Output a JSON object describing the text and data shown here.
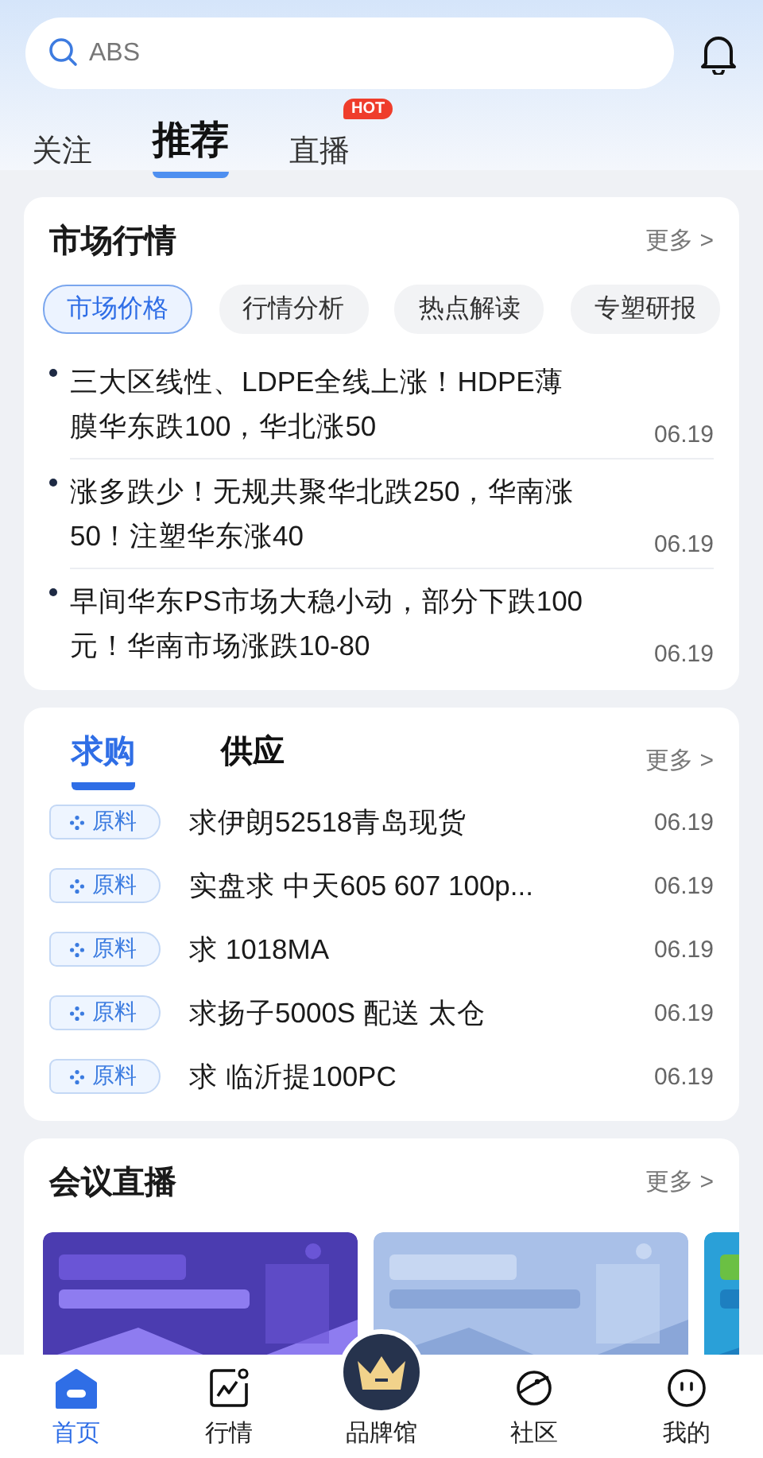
{
  "search": {
    "placeholder": "ABS"
  },
  "top_tabs": [
    {
      "label": "关注",
      "selected": false
    },
    {
      "label": "推荐",
      "selected": true
    },
    {
      "label": "直播",
      "selected": false,
      "badge": "HOT"
    }
  ],
  "market": {
    "title": "市场行情",
    "more": "更多 >",
    "chips": [
      {
        "label": "市场价格",
        "selected": true
      },
      {
        "label": "行情分析",
        "selected": false
      },
      {
        "label": "热点解读",
        "selected": false
      },
      {
        "label": "专塑研报",
        "selected": false
      }
    ],
    "news": [
      {
        "title": "三大区线性、LDPE全线上涨！HDPE薄膜华东跌100，华北涨50",
        "date": "06.19"
      },
      {
        "title": "涨多跌少！无规共聚华北跌250，华南涨50！注塑华东涨40",
        "date": "06.19"
      },
      {
        "title": "早间华东PS市场大稳小动，部分下跌100元！华南市场涨跌10-80",
        "date": "06.19"
      }
    ]
  },
  "trade": {
    "more": "更多 >",
    "tabs": [
      {
        "label": "求购",
        "selected": true
      },
      {
        "label": "供应",
        "selected": false
      }
    ],
    "rows": [
      {
        "tag": "原料",
        "title": "求伊朗52518青岛现货",
        "date": "06.19"
      },
      {
        "tag": "原料",
        "title": "实盘求 中天605 607 100p...",
        "date": "06.19"
      },
      {
        "tag": "原料",
        "title": "求 1018MA",
        "date": "06.19"
      },
      {
        "tag": "原料",
        "title": "求扬子5000S 配送 太仓",
        "date": "06.19"
      },
      {
        "tag": "原料",
        "title": "求 临沂提100PC",
        "date": "06.19"
      }
    ]
  },
  "live": {
    "title": "会议直播",
    "more": "更多 >"
  },
  "bottom_nav": [
    {
      "label": "首页",
      "selected": true,
      "kind": "tab"
    },
    {
      "label": "行情",
      "selected": false,
      "kind": "tab"
    },
    {
      "label": "品牌馆",
      "selected": false,
      "kind": "featured"
    },
    {
      "label": "社区",
      "selected": false,
      "kind": "tab"
    },
    {
      "label": "我的",
      "selected": false,
      "kind": "tab"
    }
  ]
}
